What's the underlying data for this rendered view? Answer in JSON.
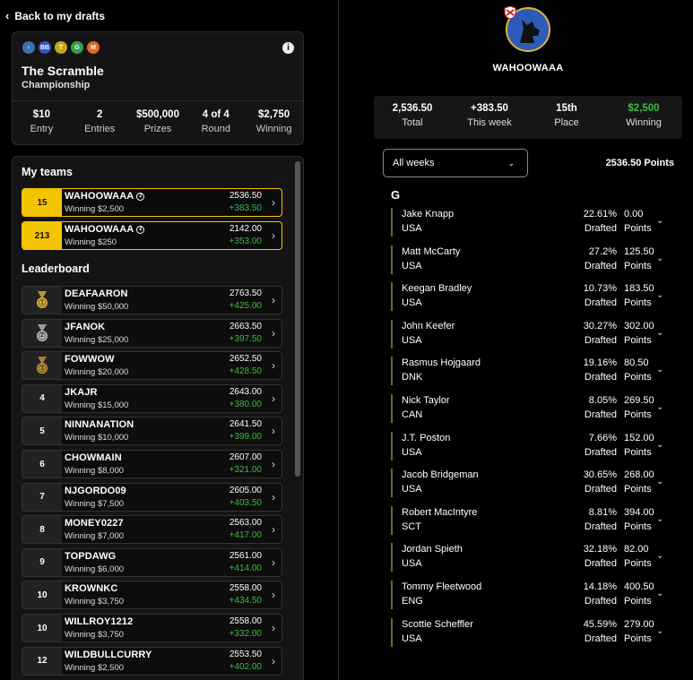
{
  "back_label": "Back to my drafts",
  "contest": {
    "badges": [
      {
        "text": "♀",
        "color": "#3a6fb0",
        "icon": "female-icon"
      },
      {
        "text": "BB",
        "color": "#2f56c9",
        "icon": "bb-badge"
      },
      {
        "text": "T",
        "color": "#c9a51b",
        "icon": "t-badge"
      },
      {
        "text": "G",
        "color": "#33a04a",
        "icon": "g-badge"
      },
      {
        "text": "M",
        "color": "#e0692a",
        "icon": "m-badge"
      }
    ],
    "title": "The Scramble",
    "subtitle": "Championship",
    "stats": [
      {
        "value": "$10",
        "label": "Entry"
      },
      {
        "value": "2",
        "label": "Entries"
      },
      {
        "value": "$500,000",
        "label": "Prizes"
      },
      {
        "value": "4 of 4",
        "label": "Round"
      },
      {
        "value": "$2,750",
        "label": "Winning"
      }
    ]
  },
  "my_teams_title": "My teams",
  "my_teams": [
    {
      "rank": "15",
      "name": "WAHOOWAAA",
      "winning": "Winning $2,500",
      "total": "2536.50",
      "gain": "+383.50"
    },
    {
      "rank": "213",
      "name": "WAHOOWAAA",
      "winning": "Winning $250",
      "total": "2142.00",
      "gain": "+353.00"
    }
  ],
  "leaderboard_title": "Leaderboard",
  "leaderboard": [
    {
      "rank": "1",
      "medal": "gold",
      "name": "DEAFAARON",
      "winning": "Winning $50,000",
      "total": "2763.50",
      "gain": "+425.00"
    },
    {
      "rank": "2",
      "medal": "silver",
      "name": "JFANOK",
      "winning": "Winning $25,000",
      "total": "2663.50",
      "gain": "+397.50"
    },
    {
      "rank": "3",
      "medal": "bronze",
      "name": "FOWWOW",
      "winning": "Winning $20,000",
      "total": "2652.50",
      "gain": "+428.50"
    },
    {
      "rank": "4",
      "name": "JKAJR",
      "winning": "Winning $15,000",
      "total": "2643.00",
      "gain": "+380.00"
    },
    {
      "rank": "5",
      "name": "NINNANATION",
      "winning": "Winning $10,000",
      "total": "2641.50",
      "gain": "+399.00"
    },
    {
      "rank": "6",
      "name": "CHOWMAIN",
      "winning": "Winning $8,000",
      "total": "2607.00",
      "gain": "+321.00"
    },
    {
      "rank": "7",
      "name": "NJGORDO09",
      "winning": "Winning $7,500",
      "total": "2605.00",
      "gain": "+403.50"
    },
    {
      "rank": "8",
      "name": "MONEY0227",
      "winning": "Winning $7,000",
      "total": "2563.00",
      "gain": "+417.00"
    },
    {
      "rank": "9",
      "name": "TOPDAWG",
      "winning": "Winning $6,000",
      "total": "2561.00",
      "gain": "+414.00"
    },
    {
      "rank": "10",
      "name": "KROWNKC",
      "winning": "Winning $3,750",
      "total": "2558.00",
      "gain": "+434.50"
    },
    {
      "rank": "10",
      "name": "WILLROY1212",
      "winning": "Winning $3,750",
      "total": "2558.00",
      "gain": "+332.00"
    },
    {
      "rank": "12",
      "name": "WILDBULLCURRY",
      "winning": "Winning $2,500",
      "total": "2553.50",
      "gain": "+402.00"
    }
  ],
  "team": {
    "name": "WAHOOWAAA",
    "stats": [
      {
        "value": "2,536.50",
        "label": "Total",
        "color": "#ffffff"
      },
      {
        "value": "+383.50",
        "label": "This week",
        "color": "#ffffff"
      },
      {
        "value": "15th",
        "label": "Place",
        "color": "#ffffff"
      },
      {
        "value": "$2,500",
        "label": "Winning",
        "color": "#3dbb47"
      }
    ],
    "week_select": "All weeks",
    "week_total": "2536.50 Points",
    "group": "G",
    "players": [
      {
        "name": "Jake Knapp",
        "country": "USA",
        "drafted": "22.61%",
        "points": "0.00"
      },
      {
        "name": "Matt McCarty",
        "country": "USA",
        "drafted": "27.2%",
        "points": "125.50"
      },
      {
        "name": "Keegan Bradley",
        "country": "USA",
        "drafted": "10.73%",
        "points": "183.50"
      },
      {
        "name": "John Keefer",
        "country": "USA",
        "drafted": "30.27%",
        "points": "302.00"
      },
      {
        "name": "Rasmus Hojgaard",
        "country": "DNK",
        "drafted": "19.16%",
        "points": "80.50"
      },
      {
        "name": "Nick Taylor",
        "country": "CAN",
        "drafted": "8.05%",
        "points": "269.50"
      },
      {
        "name": "J.T. Poston",
        "country": "USA",
        "drafted": "7.66%",
        "points": "152.00"
      },
      {
        "name": "Jacob Bridgeman",
        "country": "USA",
        "drafted": "30.65%",
        "points": "268.00"
      },
      {
        "name": "Robert MacIntyre",
        "country": "SCT",
        "drafted": "8.81%",
        "points": "394.00"
      },
      {
        "name": "Jordan Spieth",
        "country": "USA",
        "drafted": "32.18%",
        "points": "82.00"
      },
      {
        "name": "Tommy Fleetwood",
        "country": "ENG",
        "drafted": "14.18%",
        "points": "400.50"
      },
      {
        "name": "Scottie Scheffler",
        "country": "USA",
        "drafted": "45.59%",
        "points": "279.00"
      }
    ],
    "drafted_label": "Drafted",
    "points_label": "Points"
  },
  "colors": {
    "accent": "#f5c400",
    "positive": "#3dbb47"
  }
}
